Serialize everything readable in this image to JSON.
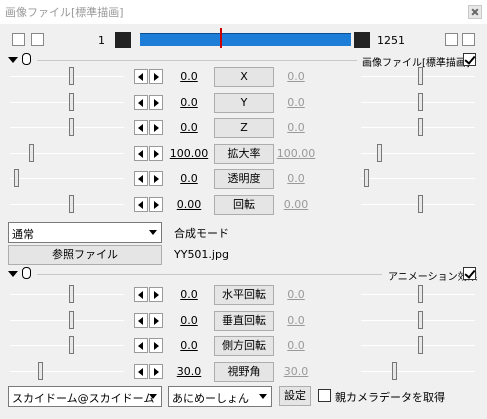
{
  "window": {
    "title": "画像ファイル[標準描画]"
  },
  "timeline": {
    "start_frame": "1",
    "end_frame": "1251"
  },
  "section1": {
    "label": "画像ファイル[標準描画]",
    "checked": true
  },
  "section2": {
    "label": "アニメーション効果",
    "checked": true
  },
  "params": [
    {
      "name": "X",
      "left_value": "0.0",
      "right_value": "0.0"
    },
    {
      "name": "Y",
      "left_value": "0.0",
      "right_value": "0.0"
    },
    {
      "name": "Z",
      "left_value": "0.0",
      "right_value": "0.0"
    },
    {
      "name": "拡大率",
      "left_value": "100.00",
      "right_value": "100.00"
    },
    {
      "name": "透明度",
      "left_value": "0.0",
      "right_value": "0.0"
    },
    {
      "name": "回転",
      "left_value": "0.00",
      "right_value": "0.00"
    }
  ],
  "blend": {
    "selected": "通常",
    "label": "合成モード"
  },
  "file": {
    "button_label": "参照ファイル",
    "filename": "YY501.jpg"
  },
  "anim_params": [
    {
      "name": "水平回転",
      "left_value": "0.0",
      "right_value": "0.0"
    },
    {
      "name": "垂直回転",
      "left_value": "0.0",
      "right_value": "0.0"
    },
    {
      "name": "側方回転",
      "left_value": "0.0",
      "right_value": "0.0"
    },
    {
      "name": "視野角",
      "left_value": "30.0",
      "right_value": "30.0"
    }
  ],
  "bottom": {
    "effect_select": "スカイドーム@スカイドーム",
    "preset_select": "あにめーしょん",
    "settings_button": "設定",
    "camera_checkbox_label": "親カメラデータを取得",
    "camera_checked": false
  }
}
